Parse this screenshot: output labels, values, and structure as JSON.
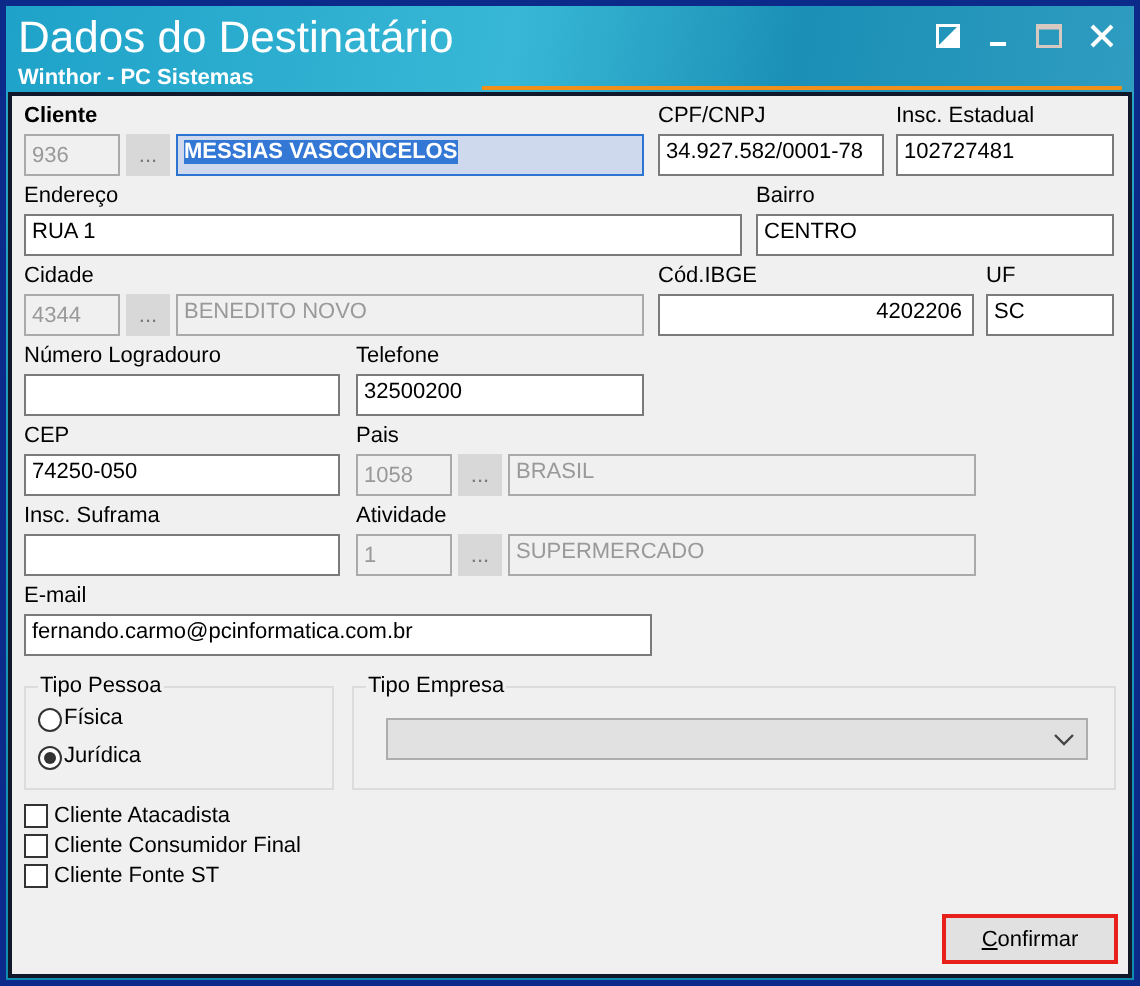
{
  "window": {
    "title": "Dados do Destinatário",
    "subtitle": "Winthor - PC Sistemas"
  },
  "rows": [
    [
      {
        "kind": "lookup",
        "label": "Cliente",
        "focused": true,
        "code": "936",
        "button": "...",
        "value": "MESSIAS VASCONCELOS",
        "disabled": false
      },
      {
        "kind": "text",
        "label": "CPF/CNPJ",
        "value": "34.927.582/0001-78"
      },
      {
        "kind": "text",
        "label": "Insc. Estadual",
        "value": "102727481"
      }
    ],
    [
      {
        "kind": "text",
        "label": "Endereço",
        "value": "RUA 1"
      },
      {
        "kind": "text",
        "label": "Bairro",
        "value": "CENTRO"
      }
    ],
    [
      {
        "kind": "lookup",
        "label": "Cidade",
        "focused": false,
        "code": "4344",
        "button": "...",
        "value": "BENEDITO NOVO",
        "disabled": true
      },
      {
        "kind": "text",
        "label": "Cód.IBGE",
        "value": "4202206"
      },
      {
        "kind": "text",
        "label": "UF",
        "value": "SC"
      }
    ],
    [
      {
        "kind": "text",
        "label": "Número Logradouro"
      },
      {
        "kind": "text",
        "label": "Telefone",
        "value": "32500200"
      }
    ],
    [
      {
        "kind": "text",
        "label": "CEP",
        "value": "74250-050"
      },
      {
        "kind": "lookup",
        "label": "Pais",
        "focused": false,
        "code": "1058",
        "button": "...",
        "value": "BRASIL",
        "disabled": true
      }
    ],
    [
      {
        "kind": "text",
        "label": "Insc. Suframa"
      },
      {
        "kind": "lookup",
        "label": "Atividade",
        "focused": false,
        "code": "1",
        "button": "...",
        "value": "SUPERMERCADO",
        "disabled": true
      }
    ],
    [
      {
        "kind": "text",
        "label": "E-mail",
        "value": "fernando.carmo@pcinformatica.com.br"
      }
    ]
  ],
  "tipo_pessoa": {
    "label": "Tipo Pessoa",
    "options": [
      {
        "label": "Física",
        "selected": false
      },
      {
        "label": "Jurídica",
        "selected": true
      }
    ]
  },
  "tipo_empresa": {
    "label": "Tipo Empresa"
  },
  "checkboxes": [
    {
      "label": "Cliente Atacadista",
      "checked": false
    },
    {
      "label": "Cliente Consumidor Final",
      "checked": false
    },
    {
      "label": "Cliente Fonte ST",
      "checked": false
    }
  ],
  "confirm_button": {
    "label": "Confirmar"
  }
}
